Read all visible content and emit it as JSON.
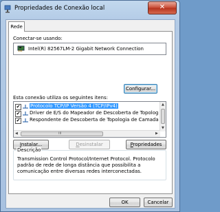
{
  "window": {
    "title": "Propriedades de Conexão local",
    "close_glyph": "✕"
  },
  "tabs": [
    {
      "label": "Rede"
    }
  ],
  "connect_using": {
    "label": "Conectar-se usando:",
    "adapter": "Intel(R) 82567LM-2 Gigabit Network Connection",
    "configure_button": "Configurar..."
  },
  "items_label": "Esta conexão utiliza os seguintes itens:",
  "items": [
    {
      "checked": true,
      "label": "Protocolo TCP/IP Versão 4 (TCP/IPv4)",
      "selected": true
    },
    {
      "checked": true,
      "label": "Driver de E/S do Mapeador de Descoberta de Topolog",
      "selected": false
    },
    {
      "checked": true,
      "label": "Respondente de Descoberta de Topologia de Camada",
      "selected": false
    }
  ],
  "checkmark": "✔",
  "scroll": {
    "up": "▲",
    "down": "▼",
    "left": "◀",
    "right": "▶",
    "grip": "III"
  },
  "buttons": {
    "install_pre": "",
    "install_u": "I",
    "install_post": "nstalar...",
    "uninstall_pre": "",
    "uninstall_u": "D",
    "uninstall_post": "esinstalar",
    "properties_pre": "",
    "properties_u": "P",
    "properties_post": "ropriedades"
  },
  "description": {
    "title": "Descrição",
    "text": "Transmission Control Protocol/Internet Protocol. Protocolo padrão de rede de longa distância que possibilita a comunicação entre diversas redes interconectadas."
  },
  "footer": {
    "ok": "OK",
    "cancel": "Cancelar"
  }
}
